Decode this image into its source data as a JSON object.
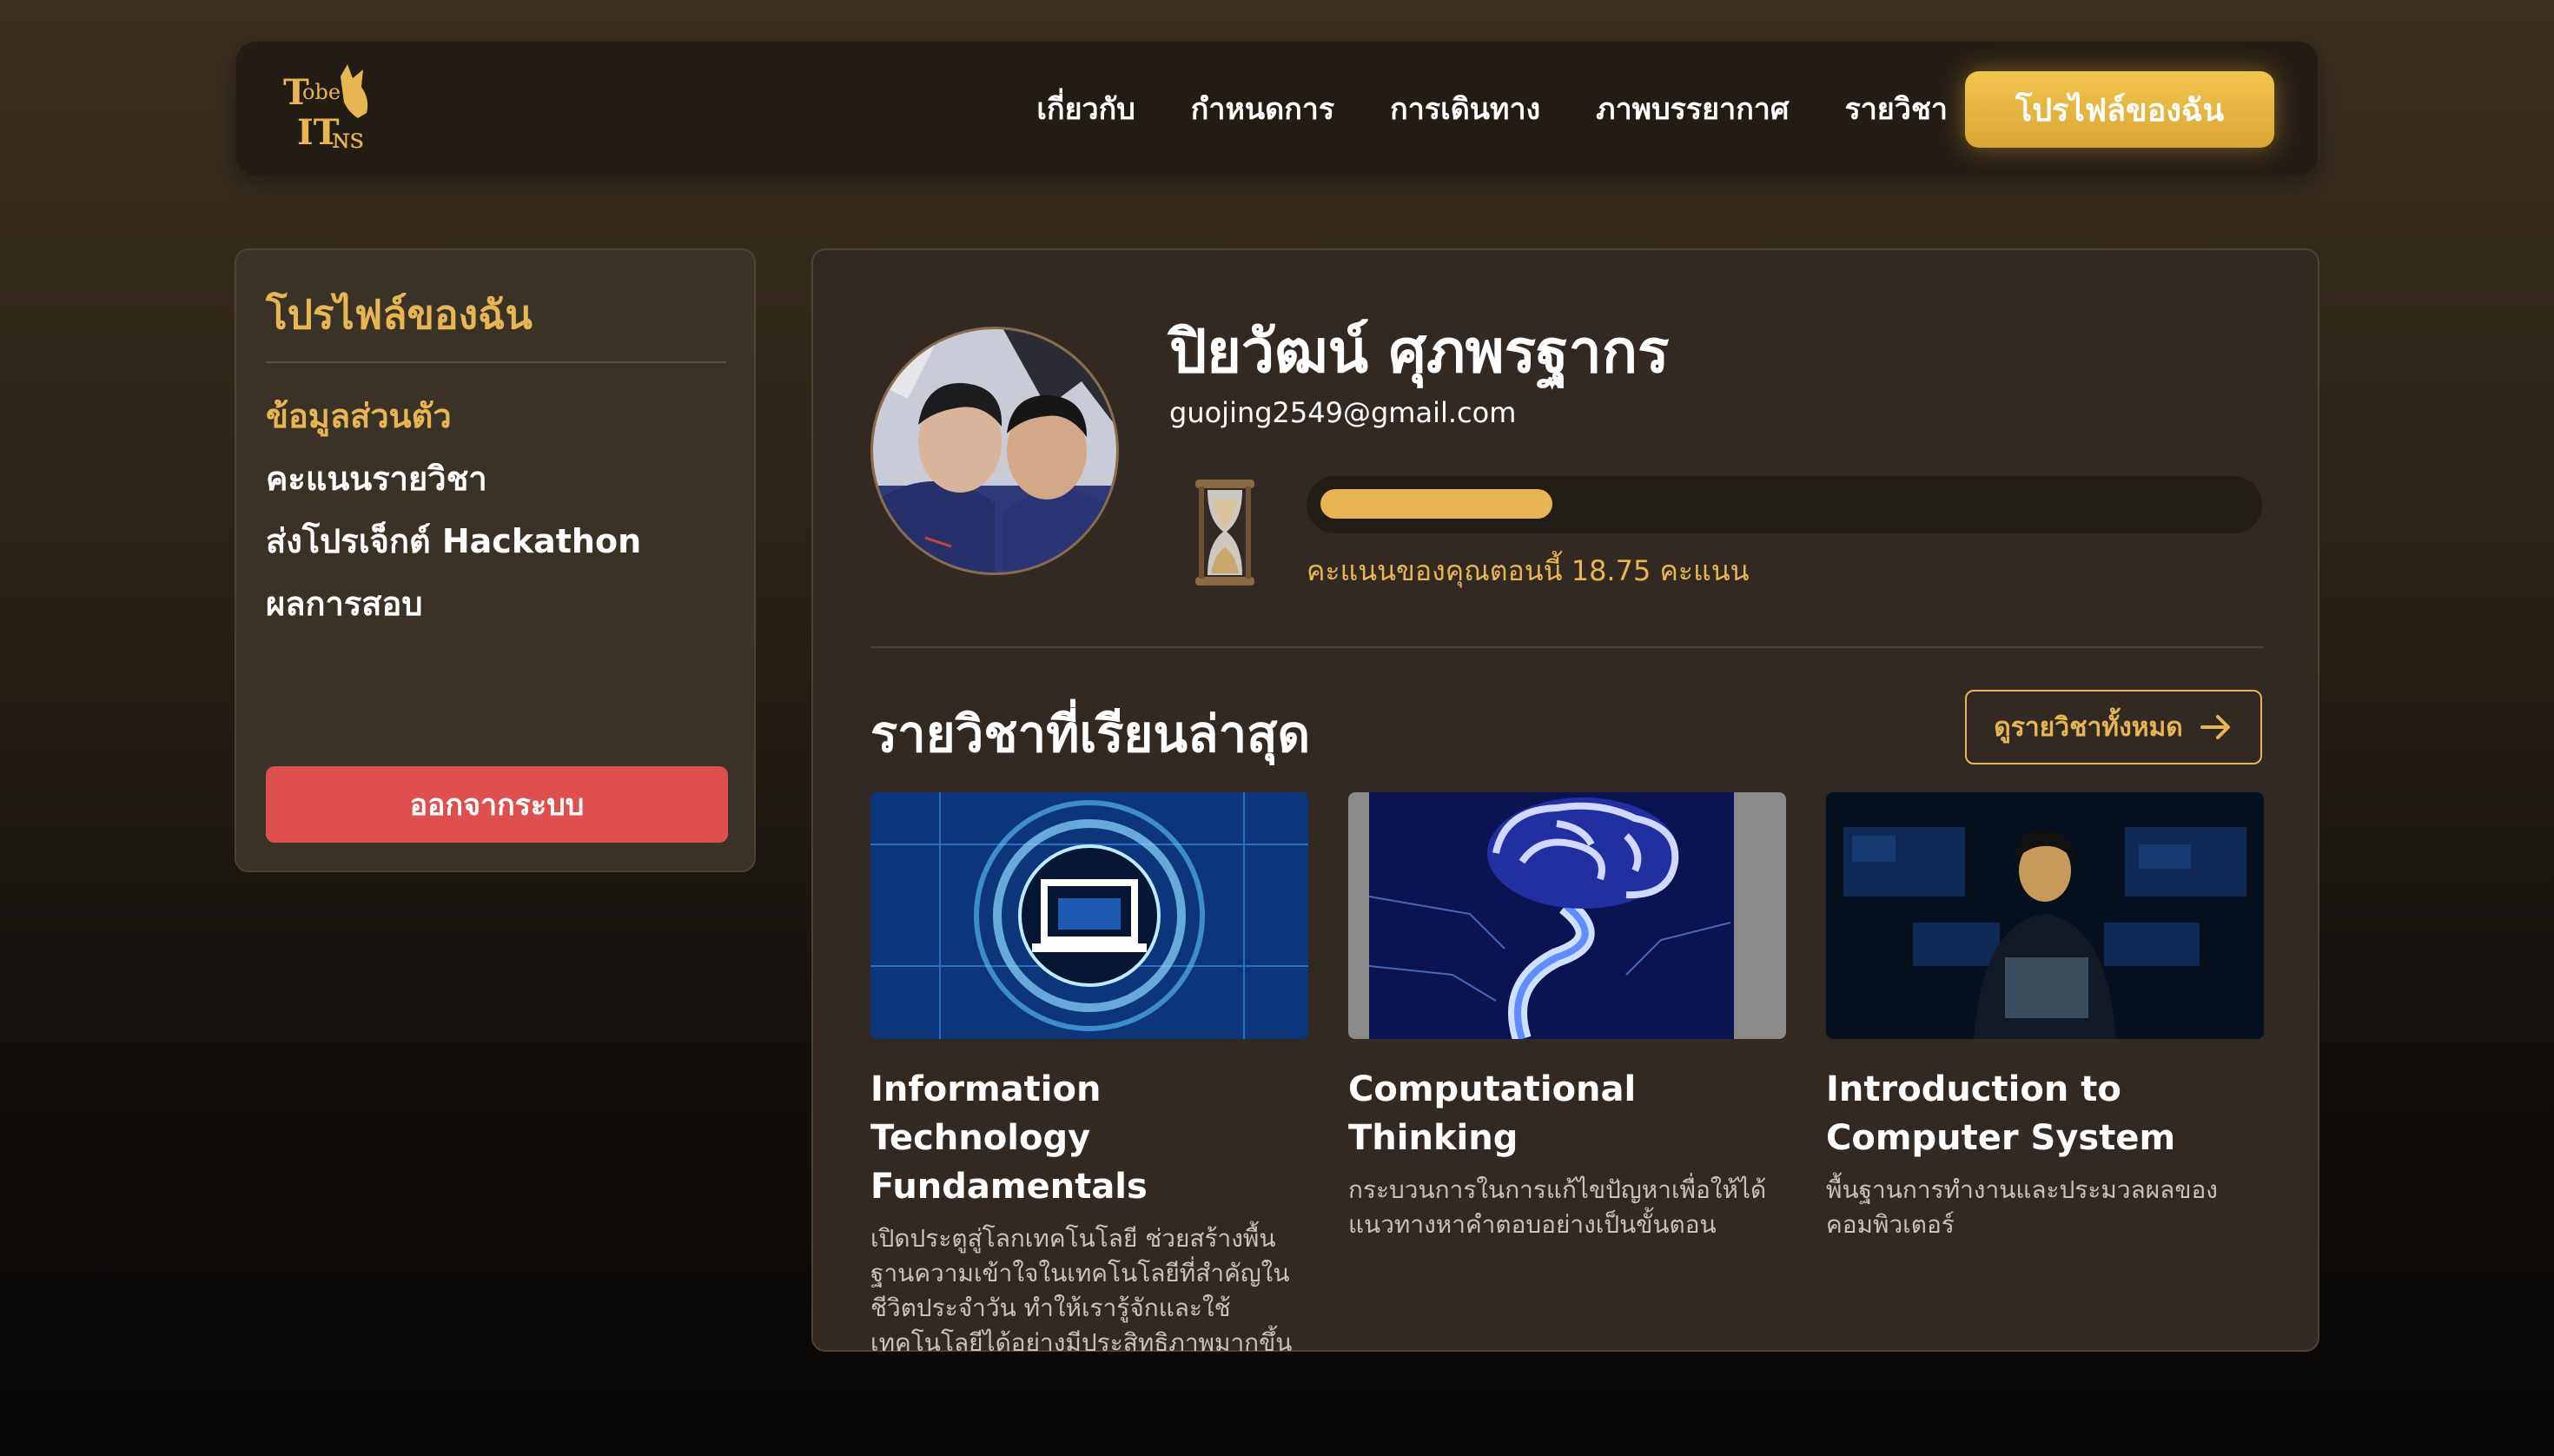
{
  "navbar": {
    "logo_alt": "Tobe IT",
    "links": [
      "เกี่ยวกับ",
      "กำหนดการ",
      "การเดินทาง",
      "ภาพบรรยากาศ",
      "รายวิชา"
    ],
    "cta_label": "โปรไฟล์ของฉัน"
  },
  "sidebar": {
    "title": "โปรไฟล์ของฉัน",
    "items": [
      {
        "label": "ข้อมูลส่วนตัว",
        "active": true
      },
      {
        "label": "คะแนนรายวิชา",
        "active": false
      },
      {
        "label": "ส่งโปรเจ็กต์ Hackathon",
        "active": false
      },
      {
        "label": "ผลการสอบ",
        "active": false
      }
    ],
    "logout_label": "ออกจากระบบ"
  },
  "profile": {
    "name": "ปิยวัฒน์ ศุภพรฐากร",
    "email": "guojing2549@gmail.com",
    "score_text": "คะแนนของคุณตอนนี้ 18.75 คะแนน",
    "progress_fraction": 0.25
  },
  "courses_section": {
    "title": "รายวิชาที่เรียนล่าสุด",
    "view_all_label": "ดูรายวิชาทั้งหมด",
    "courses": [
      {
        "title": "Information Technology Fundamentals",
        "description": "เปิดประตูสู่โลกเทคโนโลยี ช่วยสร้างพื้นฐานความเข้าใจในเทคโนโลยีที่สำคัญในชีวิตประจำวัน ทำให้เรารู้จักและใช้เทคโนโลยีได้อย่างมีประสิทธิภาพมากขึ้น"
      },
      {
        "title": "Computational Thinking",
        "description": "กระบวนการในการแก้ไขปัญหาเพื่อให้ได้แนวทางหาคำตอบอย่างเป็นขั้นตอน"
      },
      {
        "title": "Introduction to Computer System",
        "description": "พื้นฐานการทำงานและประมวลผลของคอมพิวเตอร์"
      }
    ]
  },
  "colors": {
    "accent": "#e7b552",
    "cta_gradient_top": "#f2c54f",
    "logout": "#de4f4f",
    "panel": "#312922",
    "sidebar": "#3a3127"
  }
}
